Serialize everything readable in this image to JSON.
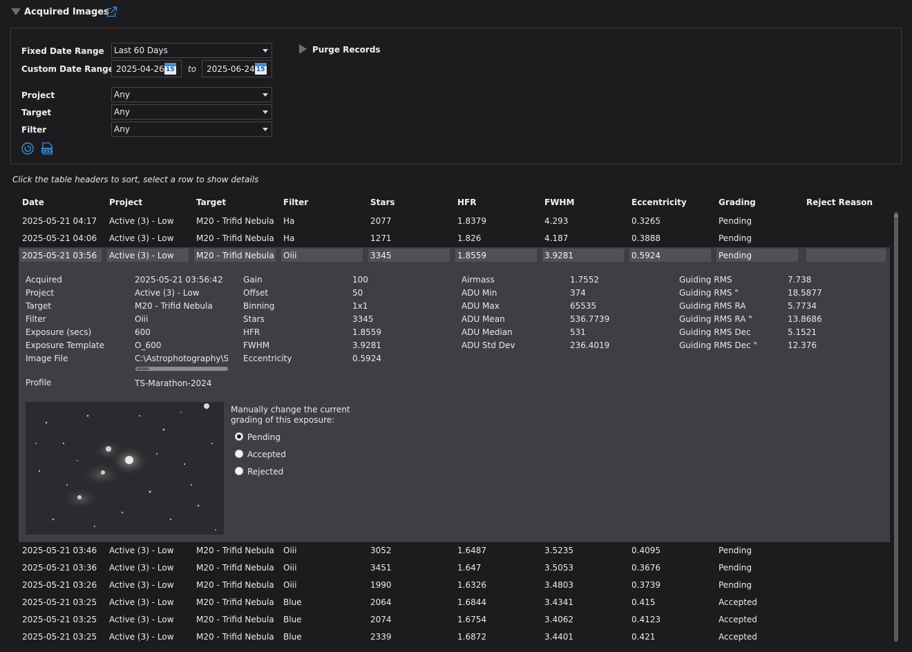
{
  "header": {
    "title": "Acquired Images"
  },
  "filters": {
    "fixed_date_label": "Fixed Date Range",
    "fixed_date_value": "Last 60 Days",
    "custom_date_label": "Custom Date Range",
    "date_from": "2025-04-26",
    "to_label": "to",
    "date_to": "2025-06-24",
    "calendar_day": "15",
    "project_label": "Project",
    "project_value": "Any",
    "target_label": "Target",
    "target_value": "Any",
    "filter_label": "Filter",
    "filter_value": "Any",
    "purge_label": "Purge Records",
    "csv_label": "CSV"
  },
  "hint": "Click the table headers to sort, select a row to show details",
  "table": {
    "columns": [
      "Date",
      "Project",
      "Target",
      "Filter",
      "Stars",
      "HFR",
      "FWHM",
      "Eccentricity",
      "Grading",
      "Reject Reason"
    ],
    "rows_top": [
      [
        "2025-05-21 04:17",
        "Active (3) - Low",
        "M20 - Trifid Nebula",
        "Ha",
        "2077",
        "1.8379",
        "4.293",
        "0.3265",
        "Pending",
        ""
      ],
      [
        "2025-05-21 04:06",
        "Active (3) - Low",
        "M20 - Trifid Nebula",
        "Ha",
        "1271",
        "1.826",
        "4.187",
        "0.3888",
        "Pending",
        ""
      ]
    ],
    "selected_row": [
      "2025-05-21 03:56",
      "Active (3) - Low",
      "M20 - Trifid Nebula",
      "Oiii",
      "3345",
      "1.8559",
      "3.9281",
      "0.5924",
      "Pending",
      ""
    ],
    "rows_bottom": [
      [
        "2025-05-21 03:46",
        "Active (3) - Low",
        "M20 - Trifid Nebula",
        "Oiii",
        "3052",
        "1.6487",
        "3.5235",
        "0.4095",
        "Pending",
        ""
      ],
      [
        "2025-05-21 03:36",
        "Active (3) - Low",
        "M20 - Trifid Nebula",
        "Oiii",
        "3451",
        "1.647",
        "3.5053",
        "0.3676",
        "Pending",
        ""
      ],
      [
        "2025-05-21 03:26",
        "Active (3) - Low",
        "M20 - Trifid Nebula",
        "Oiii",
        "1990",
        "1.6326",
        "3.4803",
        "0.3739",
        "Pending",
        ""
      ],
      [
        "2025-05-21 03:25",
        "Active (3) - Low",
        "M20 - Trifid Nebula",
        "Blue",
        "2064",
        "1.6844",
        "3.4341",
        "0.415",
        "Accepted",
        ""
      ],
      [
        "2025-05-21 03:25",
        "Active (3) - Low",
        "M20 - Trifid Nebula",
        "Blue",
        "2074",
        "1.6754",
        "3.4062",
        "0.4123",
        "Accepted",
        ""
      ],
      [
        "2025-05-21 03:25",
        "Active (3) - Low",
        "M20 - Trifid Nebula",
        "Blue",
        "2339",
        "1.6872",
        "3.4401",
        "0.421",
        "Accepted",
        ""
      ]
    ]
  },
  "details": {
    "col1": [
      [
        "Acquired",
        "2025-05-21 03:56:42"
      ],
      [
        "Project",
        "Active (3) - Low"
      ],
      [
        "Target",
        "M20 - Trifid Nebula"
      ],
      [
        "Filter",
        "Oiii"
      ],
      [
        "Exposure (secs)",
        "600"
      ],
      [
        "Exposure Template",
        "O_600"
      ],
      [
        "Image File",
        "C:\\Astrophotography\\Ses"
      ]
    ],
    "profile_label": "Profile",
    "profile_value": "TS-Marathon-2024",
    "col2": [
      [
        "Gain",
        "100"
      ],
      [
        "Offset",
        "50"
      ],
      [
        "Binning",
        "1x1"
      ],
      [
        "Stars",
        "3345"
      ],
      [
        "HFR",
        "1.8559"
      ],
      [
        "FWHM",
        "3.9281"
      ],
      [
        "Eccentricity",
        "0.5924"
      ]
    ],
    "col3": [
      [
        "Airmass",
        "1.7552"
      ],
      [
        "ADU Min",
        "374"
      ],
      [
        "ADU Max",
        "65535"
      ],
      [
        "ADU Mean",
        "536.7739"
      ],
      [
        "ADU Median",
        "531"
      ],
      [
        "ADU Std Dev",
        "236.4019"
      ]
    ],
    "col4": [
      [
        "Guiding RMS",
        "7.738"
      ],
      [
        "Guiding RMS \"",
        "18.5877"
      ],
      [
        "Guiding RMS RA",
        "5.7734"
      ],
      [
        "Guiding RMS RA \"",
        "13.8686"
      ],
      [
        "Guiding RMS Dec",
        "5.1521"
      ],
      [
        "Guiding RMS Dec \"",
        "12.376"
      ]
    ],
    "grading_prompt_line1": "Manually change the current",
    "grading_prompt_line2": "grading of this exposure:",
    "grading_options": [
      "Pending",
      "Accepted",
      "Rejected"
    ],
    "grading_selected": "Pending"
  },
  "colors": {
    "accent": "#3d8fd9",
    "background": "#1c1c1f",
    "detail_bg": "#3e3f44"
  }
}
